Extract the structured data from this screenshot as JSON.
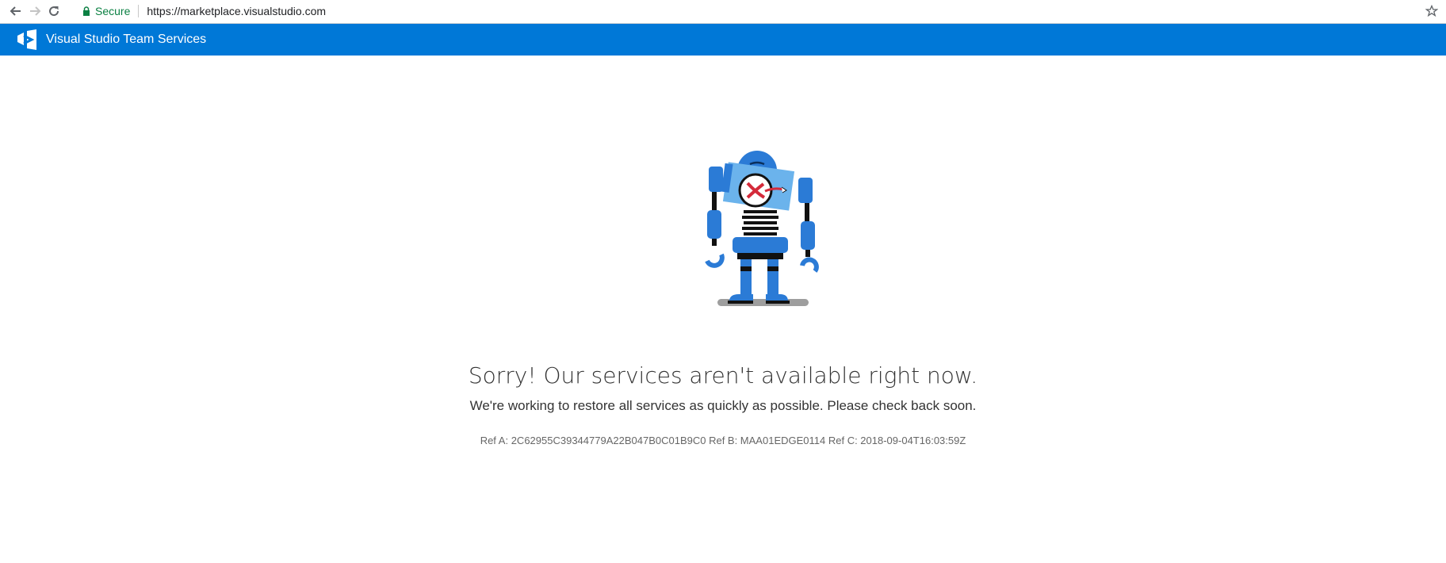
{
  "browser": {
    "secure_label": "Secure",
    "url": "https://marketplace.visualstudio.com"
  },
  "header": {
    "title": "Visual Studio Team Services",
    "background_color": "#0078d7"
  },
  "main": {
    "title": "Sorry! Our services aren't available right now.",
    "subtitle": "We're working to restore all services as quickly as possible. Please check back soon.",
    "reference": "Ref A: 2C62955C39344779A22B047B0C01B9C0 Ref B: MAA01EDGE0114 Ref C: 2018-09-04T16:03:59Z"
  },
  "icons": [
    "back-arrow-icon",
    "forward-arrow-icon",
    "reload-icon",
    "lock-icon",
    "star-icon",
    "visual-studio-logo",
    "broken-robot-illustration"
  ]
}
